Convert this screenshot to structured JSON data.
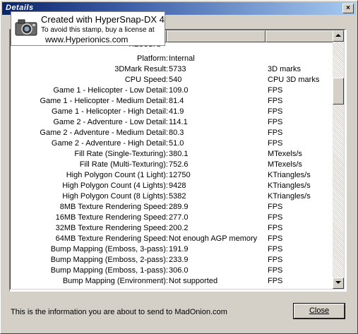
{
  "window": {
    "title": "Details",
    "close_glyph": "×"
  },
  "stamp": {
    "line1": "Created with HyperSnap-DX 4",
    "line2": "To avoid this stamp, buy a license at",
    "line3": "www.Hyperionics.com",
    "icon": "camera-icon"
  },
  "list": {
    "section_label": "RESULTS",
    "rows": [
      {
        "name": "Platform:",
        "value": "Internal",
        "unit": ""
      },
      {
        "name": "3DMark Result:",
        "value": "5733",
        "unit": "3D marks"
      },
      {
        "name": "CPU Speed:",
        "value": "540",
        "unit": "CPU 3D marks"
      },
      {
        "name": "Game 1 - Helicopter - Low Detail:",
        "value": "109.0",
        "unit": "FPS"
      },
      {
        "name": "Game 1 - Helicopter - Medium Detail:",
        "value": "81.4",
        "unit": "FPS"
      },
      {
        "name": "Game 1 - Helicopter - High Detail:",
        "value": "41.9",
        "unit": "FPS"
      },
      {
        "name": "Game 2 - Adventure - Low Detail:",
        "value": "114.1",
        "unit": "FPS"
      },
      {
        "name": "Game 2 - Adventure - Medium Detail:",
        "value": "80.3",
        "unit": "FPS"
      },
      {
        "name": "Game 2 - Adventure - High Detail:",
        "value": "51.0",
        "unit": "FPS"
      },
      {
        "name": "Fill Rate (Single-Texturing):",
        "value": "380.1",
        "unit": "MTexels/s"
      },
      {
        "name": "Fill Rate (Multi-Texturing):",
        "value": "752.6",
        "unit": "MTexels/s"
      },
      {
        "name": "High Polygon Count (1 Light):",
        "value": "12750",
        "unit": "KTriangles/s"
      },
      {
        "name": "High Polygon Count (4 Lights):",
        "value": "9428",
        "unit": "KTriangles/s"
      },
      {
        "name": "High Polygon Count (8 Lights):",
        "value": "5382",
        "unit": "KTriangles/s"
      },
      {
        "name": "8MB Texture Rendering Speed:",
        "value": "289.9",
        "unit": "FPS"
      },
      {
        "name": "16MB Texture Rendering Speed:",
        "value": "277.0",
        "unit": "FPS"
      },
      {
        "name": "32MB Texture Rendering Speed:",
        "value": "200.2",
        "unit": "FPS"
      },
      {
        "name": "64MB Texture Rendering Speed:",
        "value": "Not enough AGP memory",
        "unit": "FPS"
      },
      {
        "name": "Bump Mapping (Emboss, 3-pass):",
        "value": "191.9",
        "unit": "FPS"
      },
      {
        "name": "Bump Mapping (Emboss, 2-pass):",
        "value": "233.9",
        "unit": "FPS"
      },
      {
        "name": "Bump Mapping (Emboss, 1-pass):",
        "value": "306.0",
        "unit": "FPS"
      },
      {
        "name": "Bump Mapping (Environment):",
        "value": "Not supported",
        "unit": "FPS"
      }
    ]
  },
  "footer": {
    "info_text": "This is the information you are about to send to MadOnion.com",
    "close_label": "Close"
  }
}
